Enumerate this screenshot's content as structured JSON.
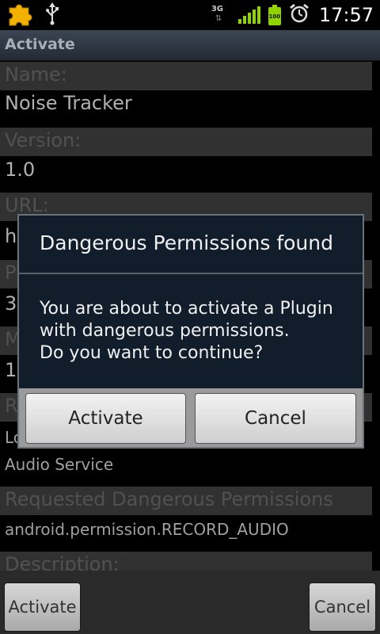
{
  "status_bar": {
    "icons": [
      "puzzle-icon",
      "usb-icon",
      "network-3g-icon",
      "signal-icon",
      "battery-icon",
      "alarm-icon"
    ],
    "network_type": "3G",
    "battery_level": "100",
    "time": "17:57",
    "colors": {
      "puzzle": "#f2b100",
      "signal": "#8fd400",
      "battery": "#8fd400"
    }
  },
  "titlebar": {
    "title": "Activate"
  },
  "form": {
    "name_header": "Name:",
    "name_value": "Noise Tracker",
    "version_header": "Version:",
    "version_value": "1.0",
    "url_header": "URL:",
    "url_value": "h",
    "p_header": "P",
    "p_value": "3",
    "m_header": "M",
    "m_value": "1",
    "r_header": "R",
    "lo_value": "Lo",
    "audio_service": "Audio Service",
    "requested_header": "Requested Dangerous Permissions",
    "permission": "android.permission.RECORD_AUDIO",
    "description_header": "Description:"
  },
  "dialog": {
    "title": "Dangerous Permissions found",
    "message": "You are about to activate a Plugin\nwith dangerous permissions.\nDo you want to continue?",
    "activate_label": "Activate",
    "cancel_label": "Cancel"
  },
  "bottom_bar": {
    "activate_label": "Activate",
    "cancel_label": "Cancel"
  }
}
